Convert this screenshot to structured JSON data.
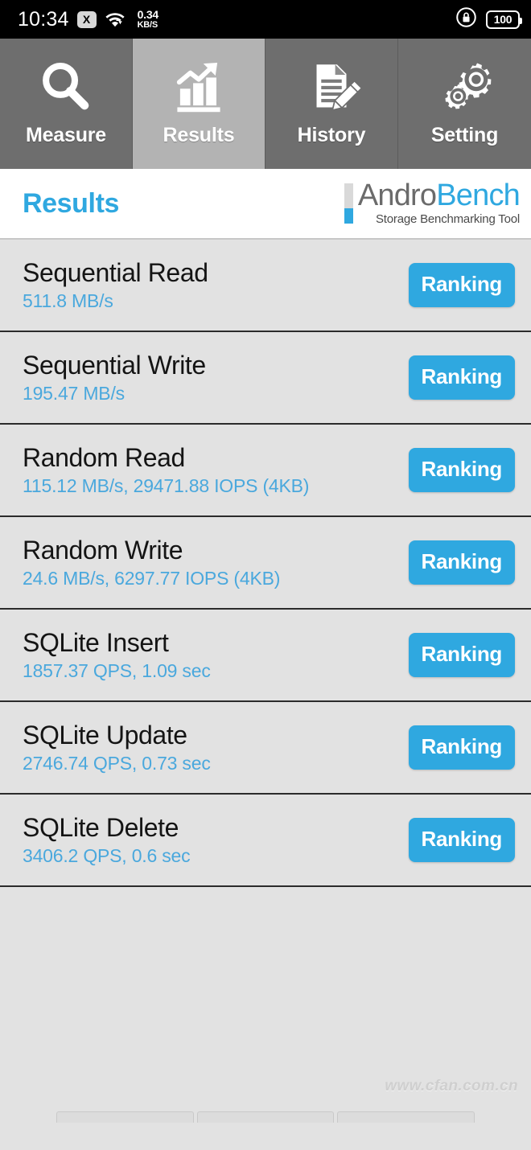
{
  "status_bar": {
    "time": "10:34",
    "mute_glyph": "X",
    "network_speed_value": "0.34",
    "network_speed_unit": "KB/S",
    "battery_level": "100",
    "icons": [
      "mute-icon",
      "wifi-icon",
      "rotation-lock-icon",
      "battery-icon"
    ]
  },
  "tabs": [
    {
      "label": "Measure",
      "icon": "magnifier-icon",
      "active": false
    },
    {
      "label": "Results",
      "icon": "bar-chart-arrow-icon",
      "active": true
    },
    {
      "label": "History",
      "icon": "document-pencil-icon",
      "active": false
    },
    {
      "label": "Setting",
      "icon": "gears-icon",
      "active": false
    }
  ],
  "header": {
    "title": "Results",
    "brand_first": "Andro",
    "brand_second": "Bench",
    "tagline": "Storage Benchmarking Tool"
  },
  "results": [
    {
      "title": "Sequential Read",
      "value": "511.8 MB/s",
      "button": "Ranking"
    },
    {
      "title": "Sequential Write",
      "value": "195.47 MB/s",
      "button": "Ranking"
    },
    {
      "title": "Random Read",
      "value": "115.12 MB/s, 29471.88 IOPS (4KB)",
      "button": "Ranking"
    },
    {
      "title": "Random Write",
      "value": "24.6 MB/s, 6297.77 IOPS (4KB)",
      "button": "Ranking"
    },
    {
      "title": "SQLite Insert",
      "value": "1857.37 QPS, 1.09 sec",
      "button": "Ranking"
    },
    {
      "title": "SQLite Update",
      "value": "2746.74 QPS, 0.73 sec",
      "button": "Ranking"
    },
    {
      "title": "SQLite Delete",
      "value": "3406.2 QPS, 0.6 sec",
      "button": "Ranking"
    }
  ],
  "watermark": "www.cfan.com.cn",
  "colors": {
    "accent_blue": "#2fa8e0",
    "value_blue": "#4aa8dd",
    "tab_inactive": "#6e6e6e",
    "tab_active": "#b3b3b3",
    "list_bg": "#e2e2e2",
    "row_divider": "#2b2b2b",
    "status_bar_bg": "#000000"
  }
}
